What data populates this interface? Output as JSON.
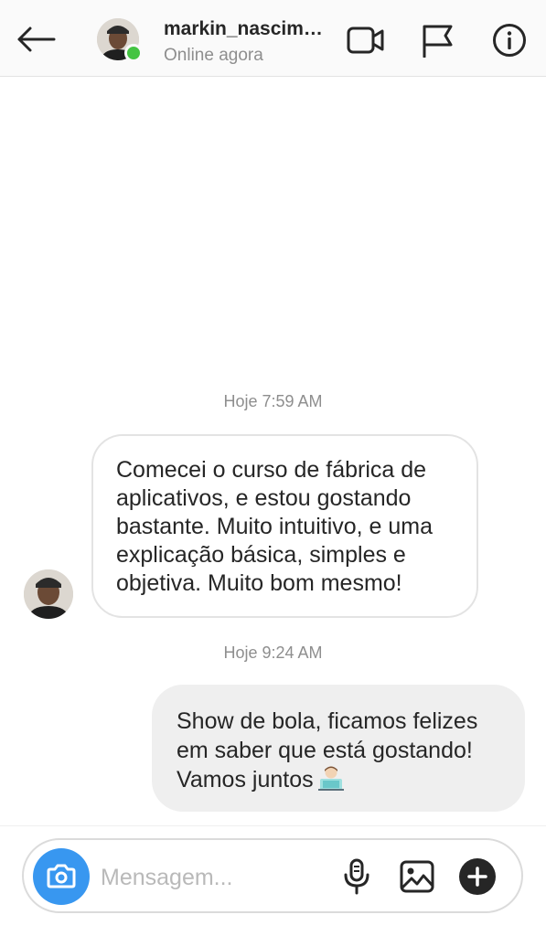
{
  "header": {
    "username": "markin_nascim…",
    "status": "Online agora",
    "icons": [
      "back-arrow-icon",
      "video-call-icon",
      "flag-icon",
      "info-icon"
    ]
  },
  "messages": [
    {
      "timestamp": "Hoje 7:59 AM",
      "direction": "incoming",
      "lines": [
        "Comecei o curso de fábrica de",
        "aplicativos, e estou gostando",
        "bastante. Muito intuitivo, e uma",
        "explicação básica, simples e",
        "objetiva. Muito bom mesmo!"
      ]
    },
    {
      "timestamp": "Hoje 9:24 AM",
      "direction": "outgoing",
      "lines": [
        "Show de bola, ficamos felizes",
        "em saber que está gostando!",
        "Vamos juntos"
      ],
      "emoji": "technologist-emoji"
    }
  ],
  "composer": {
    "placeholder": "Mensagem...",
    "icons": [
      "camera-icon",
      "microphone-icon",
      "gallery-icon",
      "plus-icon"
    ]
  },
  "colors": {
    "online": "#44c442",
    "camera_button": "#3897f0",
    "outgoing_bubble": "#efefef",
    "muted_text": "#8e8e8e"
  }
}
